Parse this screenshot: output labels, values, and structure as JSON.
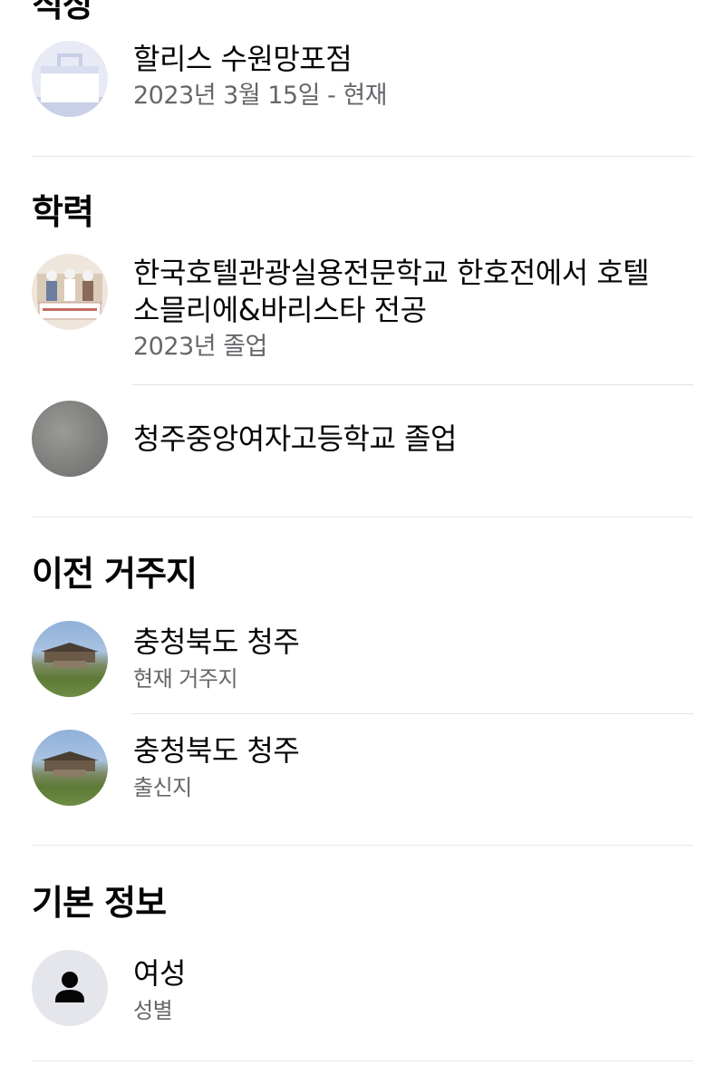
{
  "work": {
    "section_title": "직장",
    "item": {
      "name": "할리스 수원망포점",
      "dates": "2023년 3월 15일 - 현재",
      "icon": "briefcase-icon"
    }
  },
  "education": {
    "section_title": "학력",
    "items": [
      {
        "name_line1": "한국호텔관광실용전문학교 한호전에서 호텔",
        "name_line2": "소믈리에&바리스타 전공",
        "detail": "2023년 졸업"
      },
      {
        "name": "청주중앙여자고등학교 졸업"
      }
    ]
  },
  "places": {
    "section_title": "이전 거주지",
    "items": [
      {
        "name": "충청북도 청주",
        "detail": "현재 거주지"
      },
      {
        "name": "충청북도 청주",
        "detail": "출신지"
      }
    ]
  },
  "basic_info": {
    "section_title": "기본 정보",
    "item": {
      "value": "여성",
      "label": "성별",
      "icon": "person-icon"
    }
  }
}
